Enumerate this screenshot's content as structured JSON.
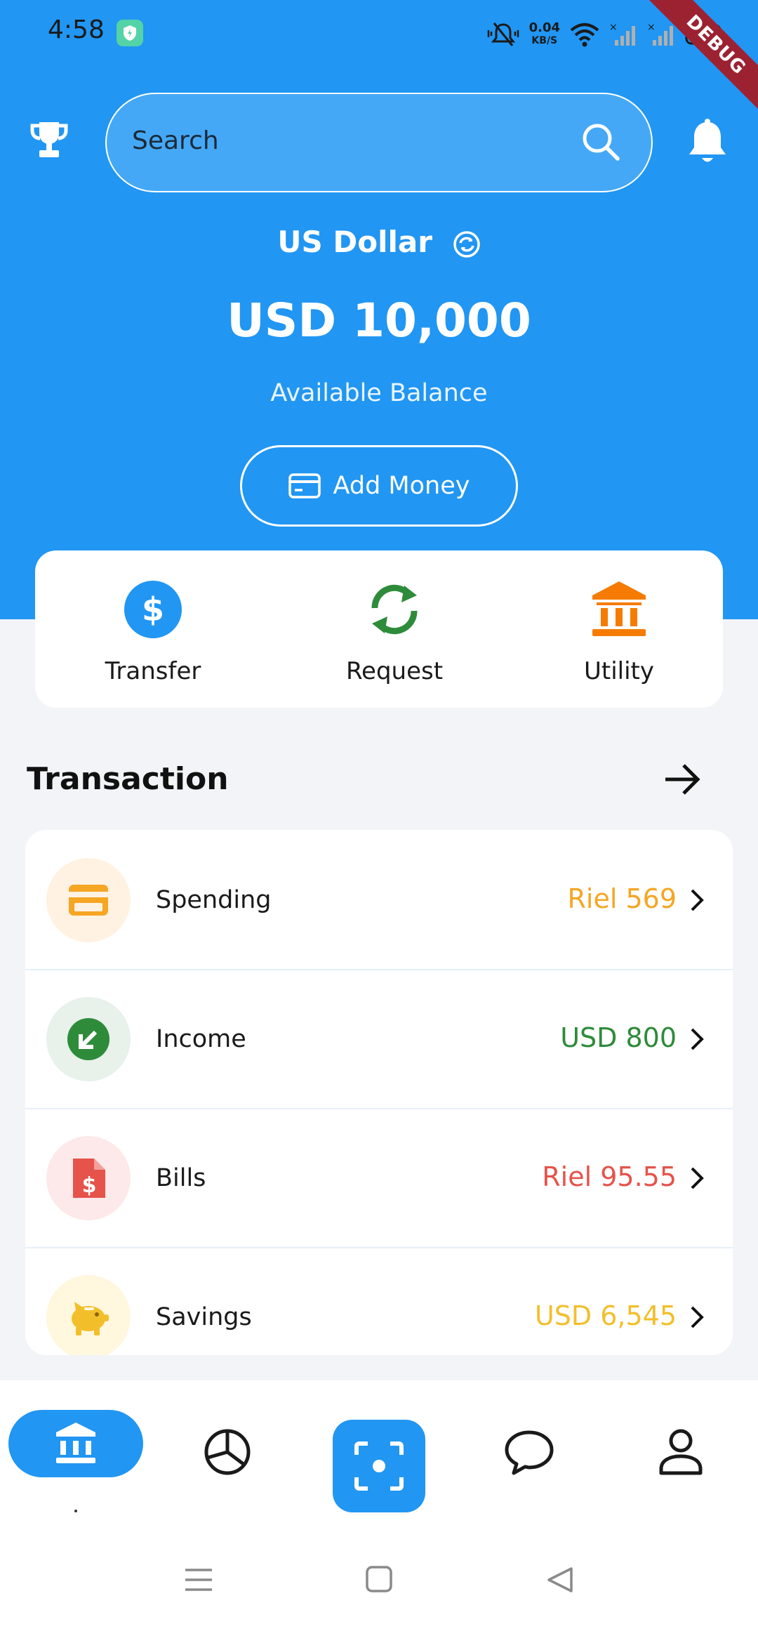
{
  "status_bar": {
    "time": "4:58",
    "net_speed_value": "0.04",
    "net_speed_unit": "KB/S",
    "debug_label": "DEBUG"
  },
  "header": {
    "search_placeholder": "Search"
  },
  "balance": {
    "currency_name": "US Dollar",
    "amount": "USD 10,000",
    "label": "Available Balance",
    "add_money_label": "Add Money"
  },
  "quick_actions": [
    {
      "label": "Transfer",
      "icon": "dollar-circle-icon",
      "color": "#2196F3"
    },
    {
      "label": "Request",
      "icon": "refresh-icon",
      "color": "#2E8B3A"
    },
    {
      "label": "Utility",
      "icon": "bank-icon",
      "color": "#F57C00"
    }
  ],
  "transactions": {
    "title": "Transaction",
    "items": [
      {
        "name": "Spending",
        "amount": "Riel 569",
        "amount_color": "#F5A623",
        "icon": "card-icon",
        "icon_bg": "#FFF2E2"
      },
      {
        "name": "Income",
        "amount": "USD 800",
        "amount_color": "#2E8B3A",
        "icon": "arrow-down-left-icon",
        "icon_bg": "#E8F1EA"
      },
      {
        "name": "Bills",
        "amount": "Riel 95.55",
        "amount_color": "#E5534B",
        "icon": "invoice-icon",
        "icon_bg": "#FDE9E9"
      },
      {
        "name": "Savings",
        "amount": "USD 6,545",
        "amount_color": "#F2BF2B",
        "icon": "piggy-bank-icon",
        "icon_bg": "#FFF7DE"
      }
    ]
  },
  "bottom_nav": {
    "items": [
      "bank-icon",
      "pie-chart-icon",
      "scan-icon",
      "chat-icon",
      "profile-icon"
    ],
    "active": "bank-icon"
  },
  "colors": {
    "primary": "#2196F3",
    "background": "#F3F4F8"
  }
}
